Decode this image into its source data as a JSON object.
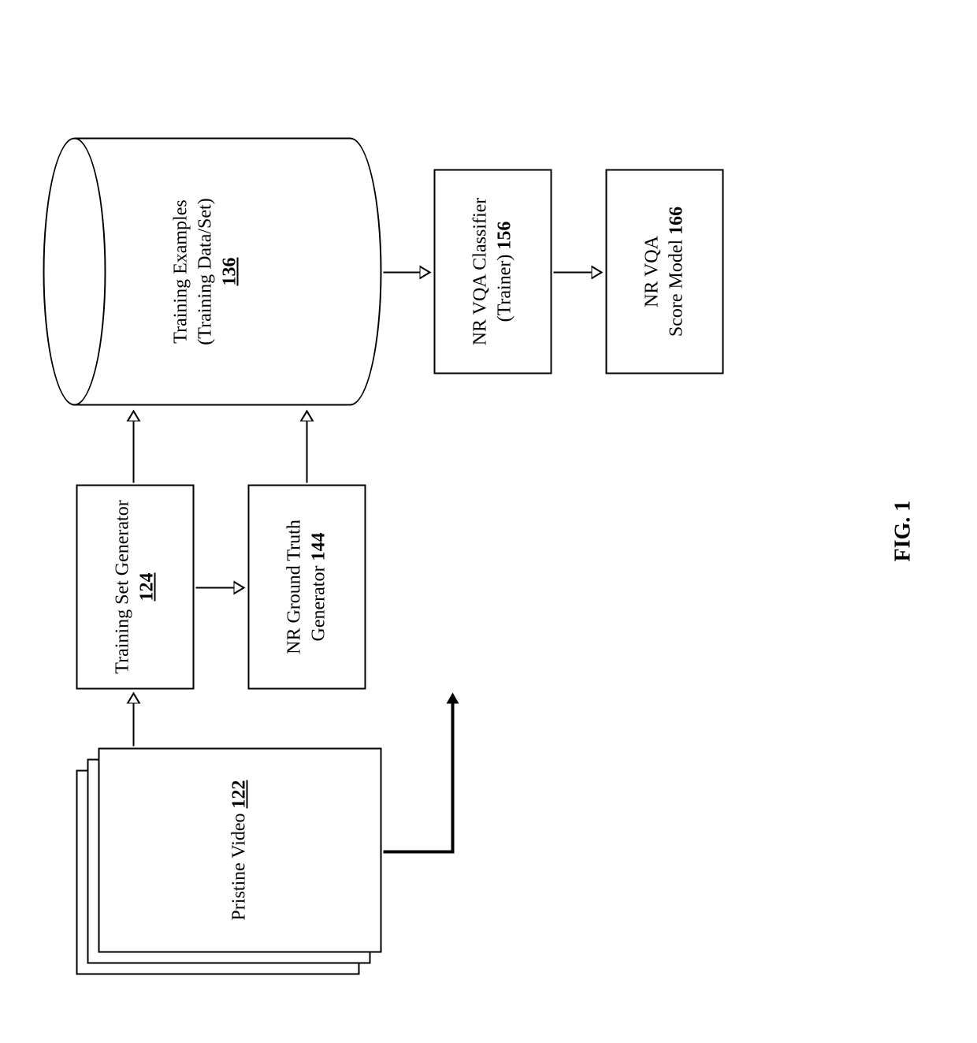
{
  "nodes": {
    "pristine": {
      "label": "Pristine Video",
      "ref": "122"
    },
    "trainGen": {
      "label": "Training Set Generator",
      "ref": "124"
    },
    "gtGen": {
      "label_line1": "NR Ground Truth",
      "label_line2": "Generator",
      "ref": "144"
    },
    "examples": {
      "label_line1": "Training Examples",
      "label_line2": "(Training Data/Set)",
      "ref": "136"
    },
    "classifier": {
      "label_line1": "NR VQA Classifier",
      "label_line2": "(Trainer)",
      "ref": "156"
    },
    "model": {
      "label_line1": "NR VQA",
      "label_line2": "Score Model",
      "ref": "166"
    }
  },
  "figure_label": "FIG. 1"
}
